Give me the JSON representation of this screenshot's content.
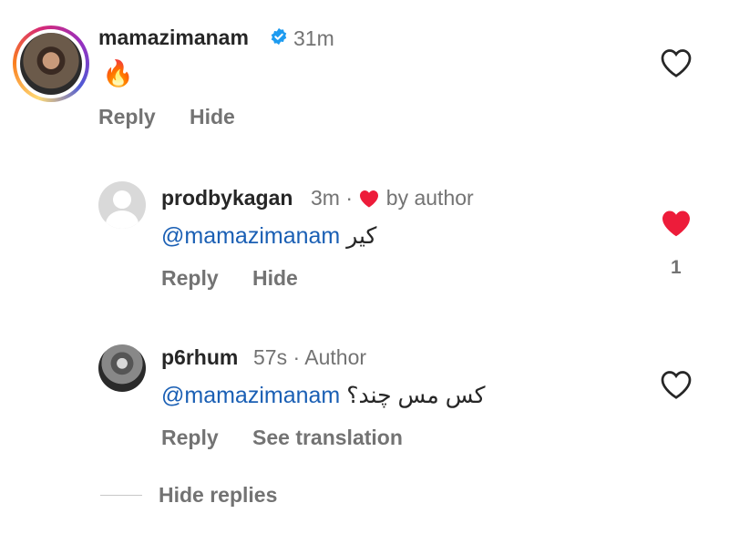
{
  "comments": [
    {
      "username": "mamazimanam",
      "time": "31m",
      "text": "🔥",
      "actions": [
        "Reply",
        "Hide"
      ]
    }
  ],
  "replies": [
    {
      "username": "prodbykagan",
      "time": "3m",
      "separator": "·",
      "liked_label": "by author",
      "mention": "@mamazimanam",
      "text": "کیر",
      "actions": [
        "Reply",
        "Hide"
      ],
      "like_count": "1"
    },
    {
      "username": "p6rhum",
      "time": "57s",
      "separator": "·",
      "author_label": "Author",
      "mention": "@mamazimanam",
      "text": "کس مس چند؟",
      "actions": [
        "Reply",
        "See translation"
      ]
    }
  ],
  "footer": {
    "hide_replies": "Hide replies"
  },
  "colors": {
    "heart_liked": "#ed1c3a",
    "mention": "#1a5fb4",
    "verified": "#1d9bf0"
  },
  "icons": [
    "heart-outline-icon",
    "heart-filled-icon",
    "verified-badge-icon",
    "fire-emoji"
  ]
}
